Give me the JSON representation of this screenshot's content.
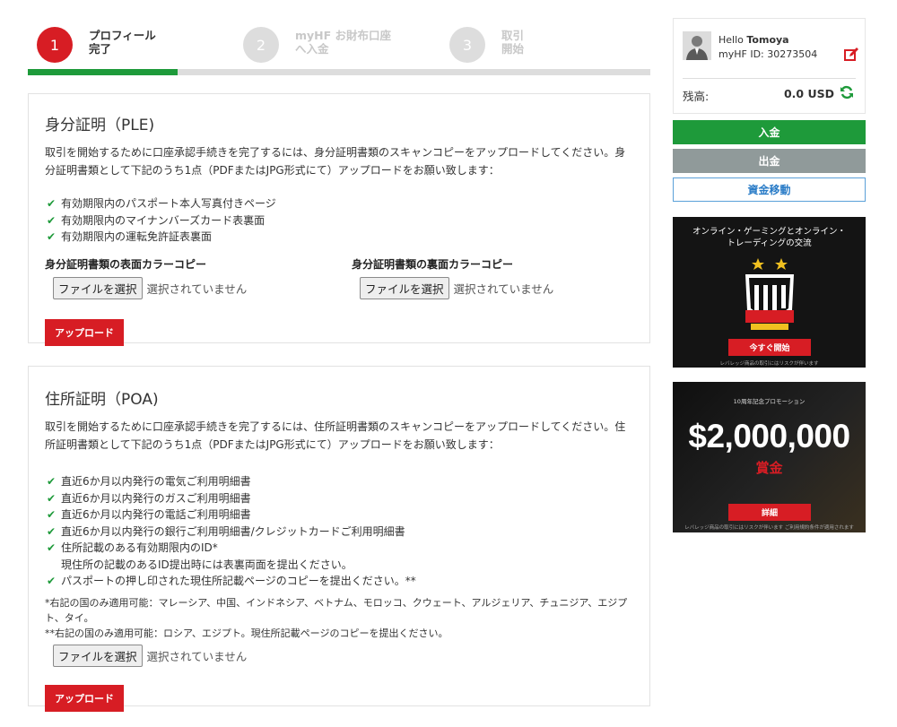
{
  "steps": [
    {
      "num": "1",
      "label_line1": "プロフィール",
      "label_line2": "完了",
      "active": true
    },
    {
      "num": "2",
      "label_line1": "myHF お財布口座",
      "label_line2": "へ入金",
      "active": false
    },
    {
      "num": "3",
      "label_line1": "取引",
      "label_line2": "開始",
      "active": false
    }
  ],
  "progress_fraction": 0.24,
  "ple": {
    "title": "身分証明（PLE)",
    "description": "取引を開始するために口座承認手続きを完了するには、身分証明書類のスキャンコピーをアップロードしてください。身分証明書類として下記のうち1点（PDFまたはJPG形式にて）アップロードをお願い致します：",
    "items": [
      "有効期限内のパスポート本人写真付きページ",
      "有効期限内のマイナンバーズカード表裏面",
      "有効期限内の運転免許証表裏面"
    ],
    "front_label": "身分証明書類の表面カラーコピー",
    "back_label": "身分証明書類の裏面カラーコピー",
    "file_button": "ファイルを選択",
    "file_status": "選択されていません",
    "upload": "アップロード"
  },
  "poa": {
    "title": "住所証明（POA)",
    "description": "取引を開始するために口座承認手続きを完了するには、住所証明書類のスキャンコピーをアップロードしてください。住所証明書類として下記のうち1点（PDFまたはJPG形式にて）アップロードをお願い致します：",
    "items": [
      "直近6か月以内発行の電気ご利用明細書",
      "直近6か月以内発行のガスご利用明細書",
      "直近6か月以内発行の電話ご利用明細書",
      "直近6か月以内発行の銀行ご利用明細書/クレジットカードご利用明細書"
    ],
    "id_item": "住所記載のある有効期限内のID*",
    "id_item_sub": "現住所の記載のあるID提出時には表裏両面を提出ください。",
    "passport_item": "パスポートの押し印された現住所記載ページのコピーを提出ください。**",
    "note1": "*右記の国のみ適用可能：マレーシア、中国、インドネシア、ベトナム、モロッコ、クウェート、アルジェリア、チュニジア、エジプト、タイ。",
    "note2": "**右記の国のみ適用可能：ロシア、エジプト。現住所記載ページのコピーを提出ください。",
    "file_button": "ファイルを選択",
    "file_status": "選択されていません",
    "upload": "アップロード"
  },
  "user": {
    "hello": "Hello",
    "name": "Tomoya",
    "id_label": "myHF ID: 30273504",
    "balance_label": "残高:",
    "balance_value": "0.0 USD"
  },
  "actions": {
    "deposit": "入金",
    "withdraw": "出金",
    "transfer": "資金移動"
  },
  "banner1": {
    "title_line1": "オンライン・ゲーミングとオンライン・",
    "title_line2": "トレーディングの交流",
    "cta": "今すぐ開始",
    "fine": "レバレッジ商品の取引にはリスクが伴います"
  },
  "banner2": {
    "small": "10周年記念プロモーション",
    "amount": "$2,000,000",
    "prize": "賞金",
    "cta": "詳細",
    "fine": "レバレッジ商品の取引にはリスクが伴います ご利用規約条件が適用されます"
  },
  "colors": {
    "brand_red": "#d71d24",
    "brand_green": "#1e9a3a",
    "withdraw_grey": "#909a9a",
    "transfer_blue": "#2a7cc7"
  }
}
